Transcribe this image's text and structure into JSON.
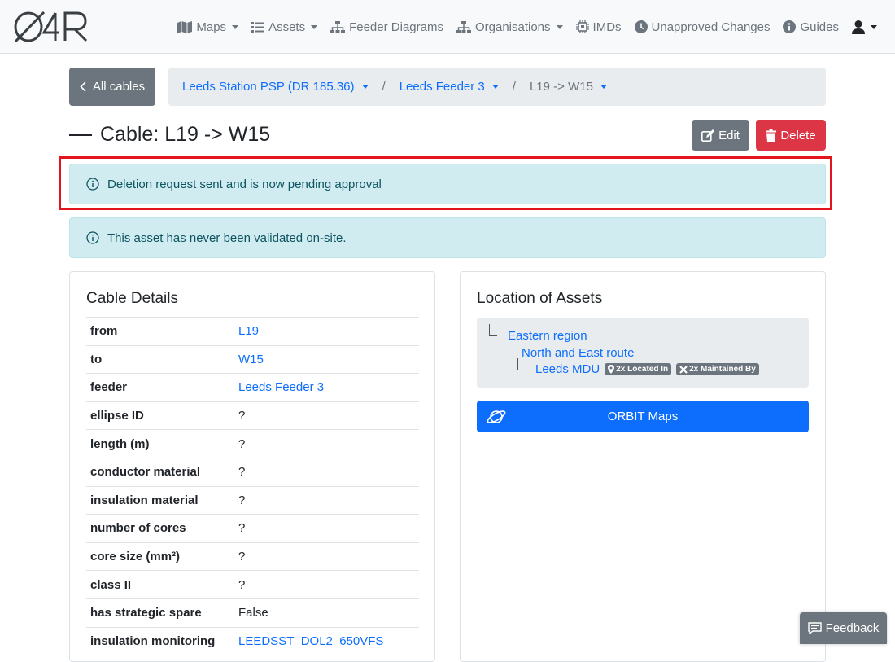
{
  "nav": {
    "logo_text": "O4R",
    "items": [
      {
        "label": "Maps",
        "icon": "map-icon",
        "dropdown": true
      },
      {
        "label": "Assets",
        "icon": "list-icon",
        "dropdown": true
      },
      {
        "label": "Feeder Diagrams",
        "icon": "sitemap-icon",
        "dropdown": false
      },
      {
        "label": "Organisations",
        "icon": "sitemap-icon",
        "dropdown": true
      },
      {
        "label": "IMDs",
        "icon": "chip-icon",
        "dropdown": false
      },
      {
        "label": "Unapproved Changes",
        "icon": "clock-icon",
        "dropdown": false
      },
      {
        "label": "Guides",
        "icon": "info-icon",
        "dropdown": false
      }
    ]
  },
  "back_button": {
    "label": "All cables"
  },
  "breadcrumb": {
    "items": [
      "Leeds Station PSP (DR 185.36)",
      "Leeds Feeder 3"
    ],
    "current": "L19 -> W15",
    "separator": "/"
  },
  "page": {
    "title": "Cable: L19 -> W15"
  },
  "actions": {
    "edit_label": "Edit",
    "delete_label": "Delete"
  },
  "alerts": {
    "deletion": "Deletion request sent and is now pending approval",
    "validation": "This asset has never been validated on-site."
  },
  "cable_details": {
    "title": "Cable Details",
    "rows": [
      {
        "key": "from",
        "value": "L19",
        "link": true
      },
      {
        "key": "to",
        "value": "W15",
        "link": true
      },
      {
        "key": "feeder",
        "value": "Leeds Feeder 3",
        "link": true
      },
      {
        "key": "ellipse ID",
        "value": "?",
        "link": false
      },
      {
        "key": "length (m)",
        "value": "?",
        "link": false
      },
      {
        "key": "conductor material",
        "value": "?",
        "link": false
      },
      {
        "key": "insulation material",
        "value": "?",
        "link": false
      },
      {
        "key": "number of cores",
        "value": "?",
        "link": false
      },
      {
        "key": "core size (mm²)",
        "value": "?",
        "link": false
      },
      {
        "key": "class II",
        "value": "?",
        "link": false
      },
      {
        "key": "has strategic spare",
        "value": "False",
        "link": false
      },
      {
        "key": "insulation monitoring",
        "value": "LEEDSST_DOL2_650VFS",
        "link": true
      }
    ]
  },
  "location": {
    "title": "Location of Assets",
    "tree": {
      "level1": "Eastern region",
      "level2": "North and East route",
      "level3": "Leeds MDU",
      "badge_located": "2x Located In",
      "badge_maintained": "2x Maintained By"
    },
    "orbit_button": "ORBIT Maps"
  },
  "feedback": {
    "label": "Feedback"
  },
  "colors": {
    "primary": "#0d6efd",
    "secondary": "#6c757d",
    "danger": "#dc3545",
    "info_bg": "#d1ecf1",
    "highlight": "#e3141e"
  }
}
